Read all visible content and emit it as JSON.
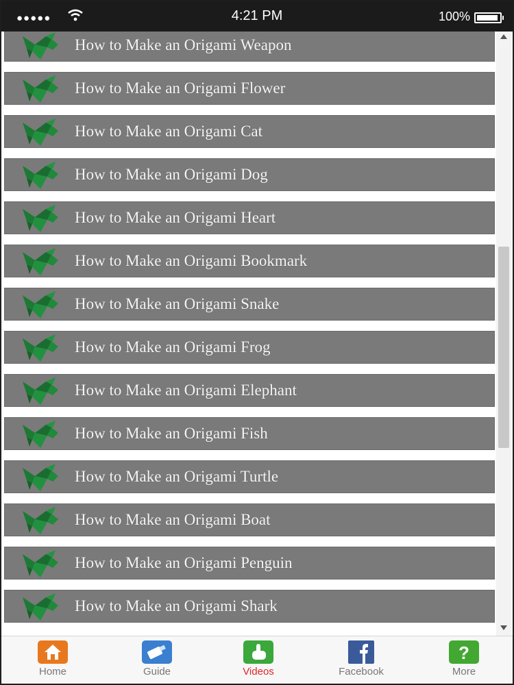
{
  "status_bar": {
    "signal": "●●●●●",
    "time": "4:21 PM",
    "battery": "100%"
  },
  "list": {
    "items": [
      {
        "label": "How to Make an Origami Weapon"
      },
      {
        "label": "How to Make an Origami Flower"
      },
      {
        "label": "How to Make an Origami Cat"
      },
      {
        "label": "How to Make an Origami Dog"
      },
      {
        "label": "How to Make an Origami Heart"
      },
      {
        "label": "How to Make an Origami Bookmark"
      },
      {
        "label": "How to Make an Origami Snake"
      },
      {
        "label": "How to Make an Origami Frog"
      },
      {
        "label": "How to Make an Origami Elephant"
      },
      {
        "label": "How to Make an Origami Fish"
      },
      {
        "label": "How to Make an Origami Turtle"
      },
      {
        "label": "How to Make an Origami Boat"
      },
      {
        "label": "How to Make an Origami Penguin"
      },
      {
        "label": "How to Make an Origami Shark"
      }
    ],
    "icon": "origami-bird-icon"
  },
  "tab_bar": {
    "tabs": [
      {
        "label": "Home",
        "icon": "home-icon",
        "color": "#e8781e",
        "active": false
      },
      {
        "label": "Guide",
        "icon": "guide-icon",
        "color": "#3a7fd0",
        "active": false
      },
      {
        "label": "Videos",
        "icon": "touch-hand-icon",
        "color": "#3aa83a",
        "active": true
      },
      {
        "label": "Facebook",
        "icon": "facebook-icon",
        "color": "#3b5a9a",
        "active": false
      },
      {
        "label": "More",
        "icon": "question-icon",
        "color": "#42a832",
        "active": false
      }
    ]
  },
  "colors": {
    "list_item_bg": "#7a7a7a",
    "active_tab": "#e0242a",
    "icon_green": "#1f8a3a"
  }
}
